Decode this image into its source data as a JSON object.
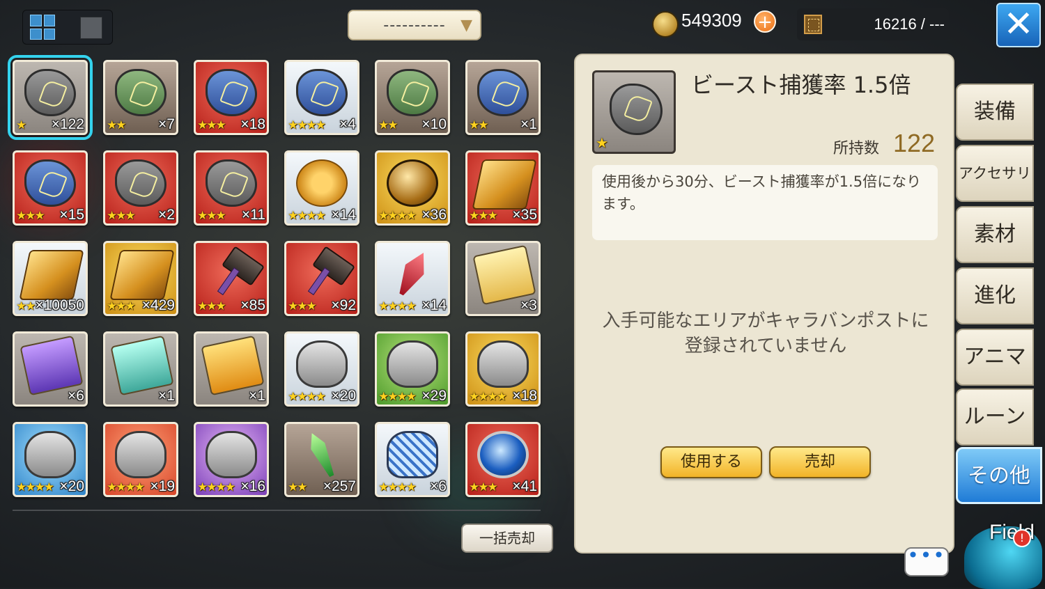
{
  "header": {
    "filter_label": "----------",
    "currency": "549309",
    "storage": "16216 / ---"
  },
  "items": [
    {
      "stars": "★",
      "count": "×122",
      "bg": "gray",
      "art": "stone-gray",
      "selected": true
    },
    {
      "stars": "★★",
      "count": "×7",
      "bg": "brown",
      "art": "stone-green"
    },
    {
      "stars": "★★★",
      "count": "×18",
      "bg": "red",
      "art": "stone-blue"
    },
    {
      "stars": "★★★★",
      "count": "×4",
      "bg": "white",
      "art": "stone-blue"
    },
    {
      "stars": "★★",
      "count": "×10",
      "bg": "brown",
      "art": "stone-green"
    },
    {
      "stars": "★★",
      "count": "×1",
      "bg": "brown",
      "art": "stone-blue"
    },
    {
      "stars": "★★★",
      "count": "×15",
      "bg": "red",
      "art": "stone-blue"
    },
    {
      "stars": "★★★",
      "count": "×2",
      "bg": "red",
      "art": "stone-gray"
    },
    {
      "stars": "★★★",
      "count": "×11",
      "bg": "red",
      "art": "stone-gray"
    },
    {
      "stars": "★★★★",
      "count": "×14",
      "bg": "white",
      "art": "coins"
    },
    {
      "stars": "★★★★",
      "count": "×36",
      "bg": "gold",
      "art": "pouch"
    },
    {
      "stars": "★★★",
      "count": "×35",
      "bg": "red",
      "art": "ingot"
    },
    {
      "stars": "★★",
      "count": "×10050",
      "bg": "white",
      "art": "ingot"
    },
    {
      "stars": "★★★",
      "count": "×429",
      "bg": "gold",
      "art": "ingot"
    },
    {
      "stars": "★★★",
      "count": "×85",
      "bg": "red",
      "art": "hammer"
    },
    {
      "stars": "★★★",
      "count": "×92",
      "bg": "red",
      "art": "hammer"
    },
    {
      "stars": "★★★★",
      "count": "×14",
      "bg": "white",
      "art": "crystal"
    },
    {
      "stars": "",
      "count": "×3",
      "bg": "gray",
      "art": "scroll-gold"
    },
    {
      "stars": "",
      "count": "×6",
      "bg": "gray",
      "art": "scroll-purple"
    },
    {
      "stars": "",
      "count": "×1",
      "bg": "gray",
      "art": "scroll-teal"
    },
    {
      "stars": "",
      "count": "×1",
      "bg": "gray",
      "art": "scroll-orange"
    },
    {
      "stars": "★★★★",
      "count": "×20",
      "bg": "white",
      "art": "head"
    },
    {
      "stars": "★★★★",
      "count": "×29",
      "bg": "green",
      "art": "head"
    },
    {
      "stars": "★★★★",
      "count": "×18",
      "bg": "gold",
      "art": "head"
    },
    {
      "stars": "★★★★",
      "count": "×20",
      "bg": "blue",
      "art": "head"
    },
    {
      "stars": "★★★★",
      "count": "×19",
      "bg": "orange",
      "art": "head"
    },
    {
      "stars": "★★★★",
      "count": "×16",
      "bg": "purple",
      "art": "head"
    },
    {
      "stars": "★★",
      "count": "×257",
      "bg": "brown",
      "art": "spear"
    },
    {
      "stars": "★★★★",
      "count": "×6",
      "bg": "white",
      "art": "vase"
    },
    {
      "stars": "★★★",
      "count": "×41",
      "bg": "red",
      "art": "orb"
    }
  ],
  "bulk_sell_label": "一括売却",
  "detail": {
    "stars": "★",
    "name": "ビースト捕獲率 1.5倍",
    "own_label": "所持数",
    "own_count": "122",
    "description": "使用後から30分、ビースト捕獲率が1.5倍になります。",
    "area_message_line1": "入手可能なエリアがキャラバンポストに",
    "area_message_line2": "登録されていません",
    "use_label": "使用する",
    "sell_label": "売却"
  },
  "tabs": [
    {
      "label": "装備",
      "active": false
    },
    {
      "label": "アクセサリ",
      "active": false
    },
    {
      "label": "素材",
      "active": false
    },
    {
      "label": "進化",
      "active": false
    },
    {
      "label": "アニマ",
      "active": false
    },
    {
      "label": "ルーン",
      "active": false
    },
    {
      "label": "その他",
      "active": true
    }
  ],
  "field_label": "Field",
  "alert_mark": "!",
  "chat_label": "•••",
  "icons": {
    "grid_view": "grid-icon",
    "list_view": "square-icon",
    "dropdown": "chevron-down-icon",
    "currency": "coin-icon",
    "plus": "plus-icon",
    "storage": "box-icon",
    "close": "close-icon"
  }
}
